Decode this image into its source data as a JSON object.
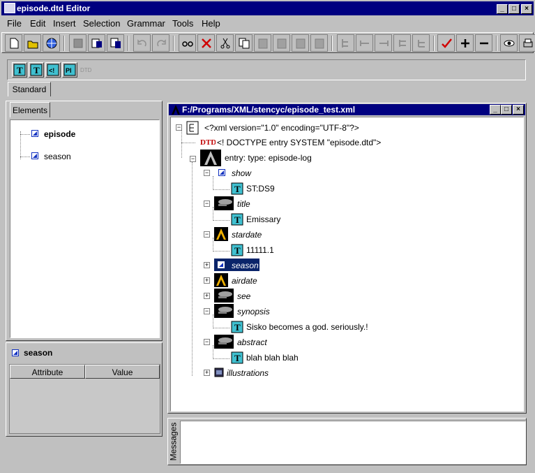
{
  "window": {
    "title": "episode.dtd Editor",
    "min": "_",
    "max": "□",
    "close": "×"
  },
  "menubar": [
    "File",
    "Edit",
    "Insert",
    "Selection",
    "Grammar",
    "Tools",
    "Help"
  ],
  "toolbar_icons": [
    "new-icon",
    "open-icon",
    "globe-open-icon",
    "save-icon",
    "save-copy-icon",
    "save-all-icon",
    "undo-icon",
    "redo-icon",
    "find-icon",
    "delete-icon",
    "cut-icon",
    "copy-icon",
    "paste-icon",
    "paste-before-icon",
    "paste-after-icon",
    "paste-into-icon",
    "tree-icon",
    "move-left-icon",
    "move-right-icon",
    "move-up-icon",
    "move-down-icon",
    "validate-icon",
    "expand-icon",
    "collapse-icon",
    "view-icon",
    "print-icon"
  ],
  "palette": {
    "tab_label": "Standard",
    "buttons": [
      "T",
      "T",
      "<!",
      "PI",
      "DTD"
    ]
  },
  "elements_panel": {
    "tab_label": "Elements",
    "items": [
      {
        "label": "episode",
        "bold": true
      },
      {
        "label": "season",
        "bold": false
      }
    ]
  },
  "attribute_panel": {
    "element": "season",
    "col_attribute": "Attribute",
    "col_value": "Value"
  },
  "document": {
    "path": "F:/Programs/XML/stencyc/episode_test.xml",
    "xml_decl": "<?xml version=\"1.0\" encoding=\"UTF-8\"?>",
    "doctype": "<! DOCTYPE entry SYSTEM  \"episode.dtd\">",
    "root": "entry:  type: episode-log",
    "nodes": [
      {
        "name": "show",
        "text": "ST:DS9"
      },
      {
        "name": "title",
        "text": "Emissary"
      },
      {
        "name": "stardate",
        "text": "11111.1"
      },
      {
        "name": "season",
        "text": ""
      },
      {
        "name": "airdate",
        "text": ""
      },
      {
        "name": "see",
        "text": ""
      },
      {
        "name": "synopsis",
        "text": "Sisko becomes a god. seriously.!"
      },
      {
        "name": "abstract",
        "text": "blah blah blah"
      },
      {
        "name": "illustrations",
        "text": ""
      }
    ],
    "selected": "season"
  },
  "messages": {
    "label": "Messages"
  }
}
